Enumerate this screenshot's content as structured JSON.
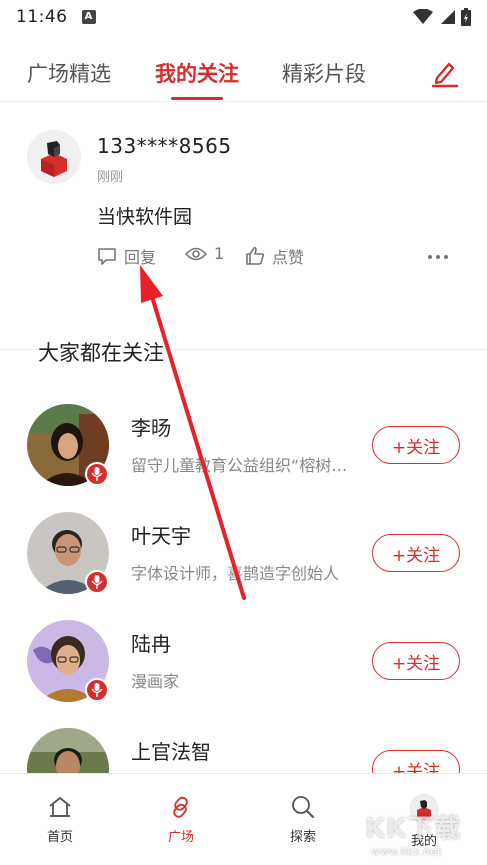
{
  "status_bar": {
    "time": "11:46",
    "notification_letter": "A"
  },
  "tabs": [
    {
      "label": "广场精选",
      "active": false
    },
    {
      "label": "我的关注",
      "active": true
    },
    {
      "label": "精彩片段",
      "active": false
    }
  ],
  "post": {
    "username": "133****8565",
    "time": "刚刚",
    "text": "当快软件园",
    "reply_label": "回复",
    "view_count": "1",
    "like_label": "点赞"
  },
  "recommend": {
    "title": "大家都在关注",
    "follow_label": "+关注",
    "users": [
      {
        "name": "李旸",
        "desc": "留守儿童教育公益组织“榕树根”…"
      },
      {
        "name": "叶天宇",
        "desc": "字体设计师，喜鹊造字创始人"
      },
      {
        "name": "陆冉",
        "desc": "漫画家"
      },
      {
        "name": "上官法智",
        "desc": ""
      }
    ]
  },
  "bottom_nav": [
    {
      "label": "首页",
      "icon": "home-icon",
      "active": false
    },
    {
      "label": "广场",
      "icon": "square-icon",
      "active": true
    },
    {
      "label": "探索",
      "icon": "explore-icon",
      "active": false
    },
    {
      "label": "我的",
      "icon": "profile-icon",
      "active": false
    }
  ],
  "watermark": {
    "brand": "KK下载",
    "url": "www.kkx.net"
  },
  "colors": {
    "accent": "#d62d2d",
    "text": "#222222",
    "muted": "#888888"
  }
}
